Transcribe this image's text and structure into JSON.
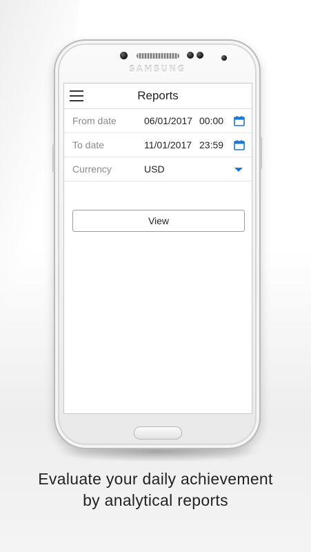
{
  "device": {
    "brand": "SAMSUNG"
  },
  "app": {
    "title": "Reports",
    "menu_icon": "hamburger-icon"
  },
  "form": {
    "from_date": {
      "label": "From date",
      "date": "06/01/2017",
      "time": "00:00",
      "icon": "calendar-icon"
    },
    "to_date": {
      "label": "To date",
      "date": "11/01/2017",
      "time": "23:59",
      "icon": "calendar-icon"
    },
    "currency": {
      "label": "Currency",
      "value": "USD",
      "icon": "dropdown-arrow-icon"
    },
    "view_label": "View"
  },
  "caption": {
    "line1": "Evaluate your daily achievement",
    "line2": "by analytical reports"
  },
  "colors": {
    "accent": "#1976d2"
  }
}
